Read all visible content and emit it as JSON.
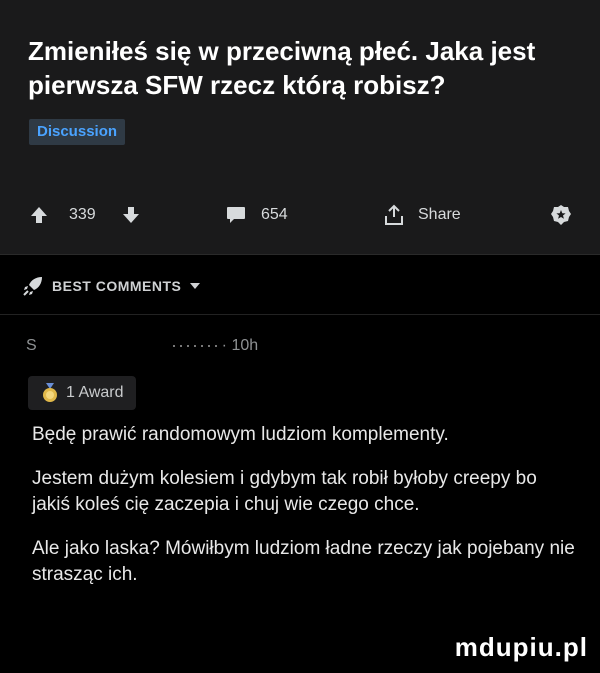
{
  "post": {
    "title": "Zmieniłeś się w przeciwną płeć. Jaka jest pierwsza SFW rzecz którą robisz?",
    "flair": "Discussion",
    "upvotes": "339",
    "comments": "654",
    "share_label": "Share"
  },
  "best_comments": {
    "label": "BEST COMMENTS"
  },
  "comment": {
    "author_initial": "S",
    "time": "· 10h",
    "award_label": "1 Award",
    "paragraphs": [
      "Będę prawić randomowym ludziom komplementy.",
      "Jestem dużym kolesiem i gdybym tak robił byłoby creepy bo jakiś koleś cię zaczepia i chuj wie czego chce.",
      "Ale jako laska? Mówiłbym ludziom ładne rzeczy jak pojebany nie strasząc ich."
    ]
  },
  "watermark": "mdupiu.pl",
  "colors": {
    "accent": "#4aa3ff",
    "post_bg": "#1a1a1b",
    "page_bg": "#000000"
  },
  "icons": [
    "upvote-icon",
    "downvote-icon",
    "comment-icon",
    "share-icon",
    "award-icon",
    "rocket-icon",
    "chevron-down-icon",
    "award-medal-icon"
  ]
}
